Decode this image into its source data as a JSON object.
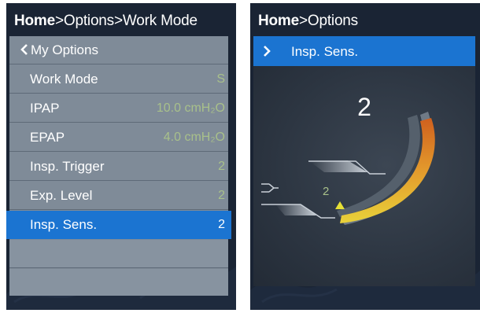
{
  "left_screen": {
    "breadcrumb": {
      "home": "Home",
      "rest": ">Options>Work Mode"
    },
    "back_item": {
      "icon": "chevron-left-icon",
      "label": "My Options"
    },
    "items": [
      {
        "label": "Work Mode",
        "value": "S"
      },
      {
        "label": "IPAP",
        "value": "10.0 cmH₂O"
      },
      {
        "label": "EPAP",
        "value": "4.0 cmH₂O"
      },
      {
        "label": "Insp. Trigger",
        "value": "2"
      },
      {
        "label": "Exp. Level",
        "value": "2"
      },
      {
        "label": "Insp. Sens.",
        "value": "2"
      }
    ],
    "selected_index": 5
  },
  "right_screen": {
    "breadcrumb": {
      "home": "Home",
      "rest": ">Options"
    },
    "selected_item": {
      "icon": "chevron-right-icon",
      "label": "Insp. Sens."
    },
    "big_value": "2",
    "indicator_value": "2"
  },
  "colors": {
    "screen_bg": "#1a2434",
    "menu_bg": "#7f8b98",
    "selected": "#1b74d1",
    "value_text": "#a8c08a",
    "arc_fill": "#e0a030",
    "indicator": "#e6e036"
  }
}
